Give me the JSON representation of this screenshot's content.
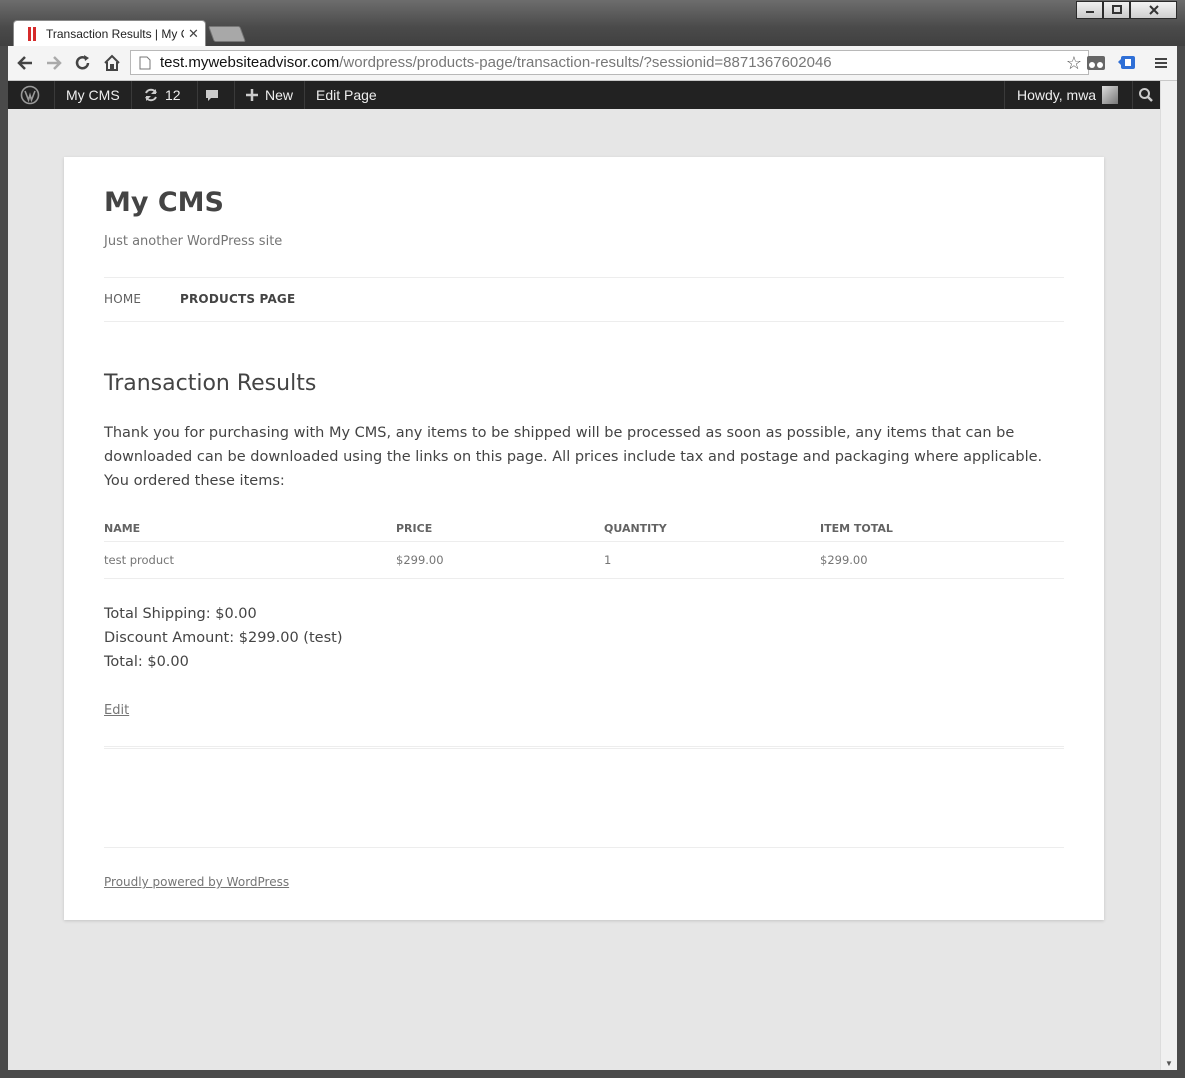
{
  "browser": {
    "tab_title": "Transaction Results | My C",
    "url_host": "test.mywebsiteadvisor.com",
    "url_path": "/wordpress/products-page/transaction-results/?sessionid=8871367602046"
  },
  "adminbar": {
    "site_name": "My CMS",
    "updates_count": "12",
    "new_label": "New",
    "edit_page_label": "Edit Page",
    "howdy_label": "Howdy, mwa"
  },
  "site": {
    "title": "My CMS",
    "description": "Just another WordPress site"
  },
  "nav": {
    "items": [
      {
        "label": "HOME"
      },
      {
        "label": "PRODUCTS PAGE"
      }
    ]
  },
  "page": {
    "title": "Transaction Results",
    "intro": "Thank you for purchasing with My CMS, any items to be shipped will be processed as soon as possible, any items that can be downloaded can be downloaded using the links on this page. All prices include tax and postage and packaging where applicable.",
    "ordered_label": "You ordered these items:"
  },
  "table": {
    "headers": [
      "NAME",
      "PRICE",
      "QUANTITY",
      "ITEM TOTAL"
    ],
    "rows": [
      [
        "test product",
        "$299.00",
        "1",
        "$299.00"
      ]
    ]
  },
  "totals": {
    "shipping": "Total Shipping: $0.00",
    "discount": "Discount Amount: $299.00 (test)",
    "total": "Total: $0.00"
  },
  "edit_link": "Edit",
  "footer": {
    "powered": "Proudly powered by WordPress"
  }
}
